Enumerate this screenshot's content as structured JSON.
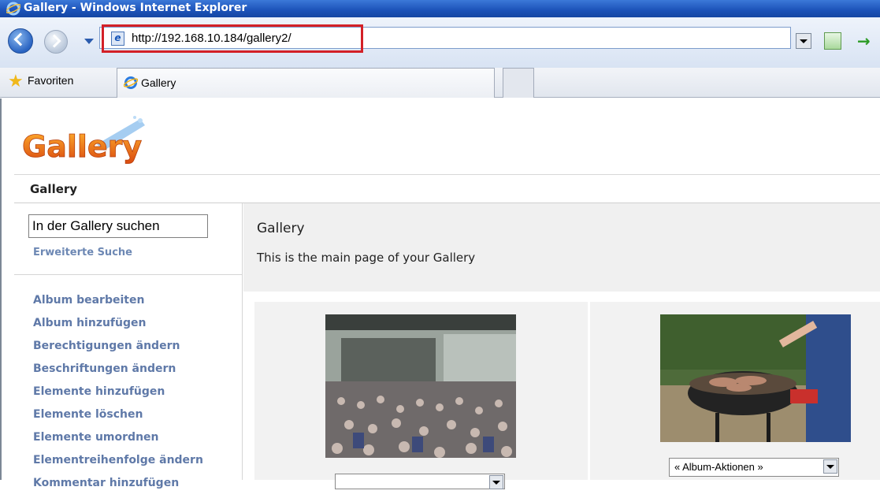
{
  "window": {
    "title": "Gallery - Windows Internet Explorer"
  },
  "nav": {
    "url": "http://192.168.10.184/gallery2/"
  },
  "tabs": {
    "favorites_label": "Favoriten",
    "active_tab": "Gallery"
  },
  "page": {
    "breadcrumb": "Gallery",
    "search": {
      "value": "In der Gallery suchen",
      "advanced": "Erweiterte Suche"
    },
    "sidebar_links": [
      "Album bearbeiten",
      "Album hinzufügen",
      "Berechtigungen ändern",
      "Beschriftungen ändern",
      "Elemente hinzufügen",
      "Elemente löschen",
      "Elemente umordnen",
      "Elementreihenfolge ändern",
      "Kommentar hinzufügen"
    ],
    "main": {
      "title": "Gallery",
      "description": "This is the main page of your Gallery"
    },
    "albums": [
      {
        "action_select": ""
      },
      {
        "action_select": "« Album-Aktionen »"
      }
    ],
    "logo_text": "Gallery"
  }
}
